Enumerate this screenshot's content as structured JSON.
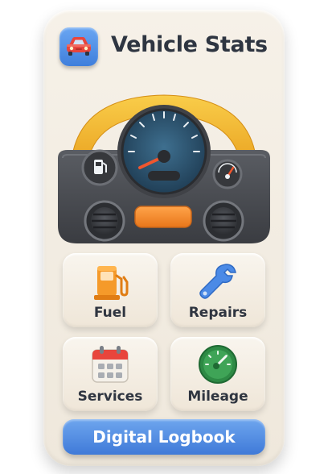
{
  "header": {
    "title": "Vehicle Stats",
    "app_icon": "car-icon"
  },
  "dashboard": {
    "icons": [
      "speedometer-icon",
      "fuel-gauge-icon",
      "temperature-gauge-icon",
      "air-vent-icon",
      "hazard-button-icon"
    ]
  },
  "tiles": [
    {
      "label": "Fuel",
      "icon": "fuel-pump-icon"
    },
    {
      "label": "Repairs",
      "icon": "wrench-icon"
    },
    {
      "label": "Services",
      "icon": "calendar-icon"
    },
    {
      "label": "Mileage",
      "icon": "odometer-icon"
    }
  ],
  "footer": {
    "button_label": "Digital Logbook"
  },
  "colors": {
    "card_background": "#f3ede3",
    "accent_blue": "#4a86e0",
    "accent_orange": "#f08a24",
    "dash_yellow": "#f2b630",
    "dash_grey": "#4a4c51",
    "text_dark": "#2e3541"
  }
}
